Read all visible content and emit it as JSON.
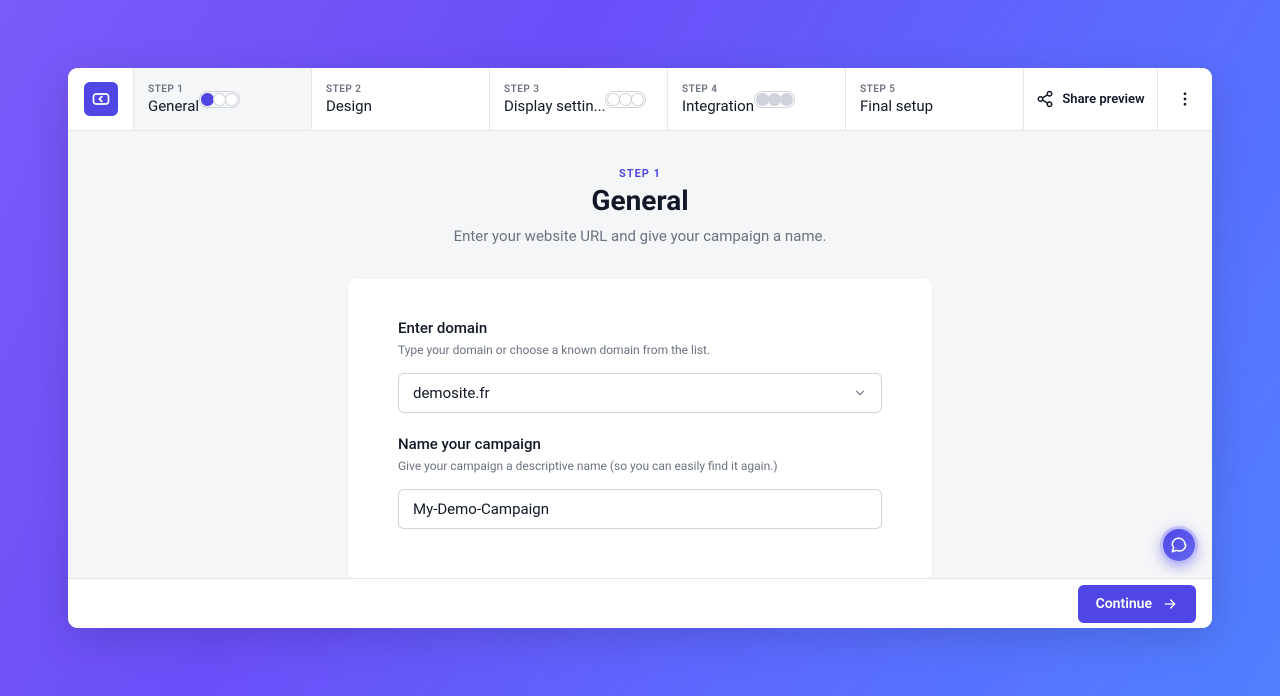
{
  "header": {
    "share": "Share preview",
    "steps": [
      {
        "label": "STEP 1",
        "name": "General",
        "dots": [
          "filled",
          "empty",
          "empty"
        ]
      },
      {
        "label": "STEP 2",
        "name": "Design"
      },
      {
        "label": "STEP 3",
        "name": "Display settin...",
        "dots": [
          "empty",
          "empty",
          "empty"
        ]
      },
      {
        "label": "STEP 4",
        "name": "Integration",
        "dots": [
          "gray",
          "gray",
          "gray"
        ]
      },
      {
        "label": "STEP 5",
        "name": "Final setup"
      }
    ]
  },
  "page": {
    "step": "STEP 1",
    "title": "General",
    "subtitle": "Enter your website URL and give your campaign a name."
  },
  "form": {
    "domain": {
      "label": "Enter domain",
      "help": "Type your domain or choose a known domain from the list.",
      "value": "demosite.fr"
    },
    "name": {
      "label": "Name your campaign",
      "help": "Give your campaign a descriptive name (so you can easily find it again.)",
      "value": "My-Demo-Campaign"
    }
  },
  "footer": {
    "continue": "Continue"
  }
}
